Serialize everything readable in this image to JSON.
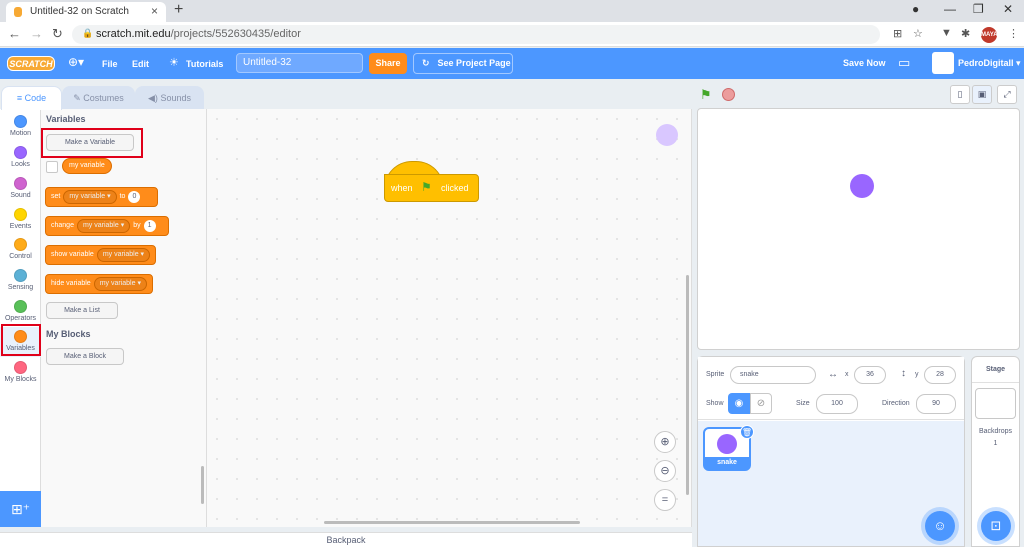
{
  "browser": {
    "tab_title": "Untitled-32 on Scratch",
    "url_host": "scratch.mit.edu",
    "url_path": "/projects/552630435/editor",
    "profile_badge": "MAYA"
  },
  "menubar": {
    "logo": "SCRATCH",
    "file": "File",
    "edit": "Edit",
    "tutorials": "Tutorials",
    "project_title": "Untitled-32",
    "share": "Share",
    "see_project": "See Project Page",
    "save_now": "Save Now",
    "username": "PedroDigitall"
  },
  "editor_tabs": {
    "code": "Code",
    "costumes": "Costumes",
    "sounds": "Sounds"
  },
  "categories": [
    {
      "label": "Motion",
      "color": "#4c97ff"
    },
    {
      "label": "Looks",
      "color": "#9966ff"
    },
    {
      "label": "Sound",
      "color": "#cf63cf"
    },
    {
      "label": "Events",
      "color": "#ffd500"
    },
    {
      "label": "Control",
      "color": "#ffab19"
    },
    {
      "label": "Sensing",
      "color": "#5cb1d6"
    },
    {
      "label": "Operators",
      "color": "#59c059"
    },
    {
      "label": "Variables",
      "color": "#ff8c1a"
    },
    {
      "label": "My Blocks",
      "color": "#ff6680"
    }
  ],
  "flyout": {
    "variables_heading": "Variables",
    "make_variable": "Make a Variable",
    "my_variable": "my variable",
    "set_block": {
      "prefix": "set",
      "var": "my variable",
      "mid": "to",
      "value": "0"
    },
    "change_block": {
      "prefix": "change",
      "var": "my variable",
      "mid": "by",
      "value": "1"
    },
    "show_block": {
      "prefix": "show variable",
      "var": "my variable"
    },
    "hide_block": {
      "prefix": "hide variable",
      "var": "my variable"
    },
    "make_list": "Make a List",
    "myblocks_heading": "My Blocks",
    "make_block": "Make a Block"
  },
  "script": {
    "hat_when": "when",
    "hat_clicked": "clicked"
  },
  "backpack": "Backpack",
  "sprite_info": {
    "sprite_label": "Sprite",
    "sprite_name": "snake",
    "x_label": "x",
    "x_value": "36",
    "y_label": "y",
    "y_value": "28",
    "show_label": "Show",
    "size_label": "Size",
    "size_value": "100",
    "direction_label": "Direction",
    "direction_value": "90"
  },
  "sprites": [
    {
      "name": "snake"
    }
  ],
  "stage_panel": {
    "title": "Stage",
    "backdrops_label": "Backdrops",
    "backdrops_count": "1"
  },
  "colors": {
    "scratch_blue": "#4c97ff",
    "variables_orange": "#ff8c1a",
    "events_yellow": "#ffbf00",
    "highlight_red": "#e0001a",
    "sprite_purple": "#9966ff"
  }
}
